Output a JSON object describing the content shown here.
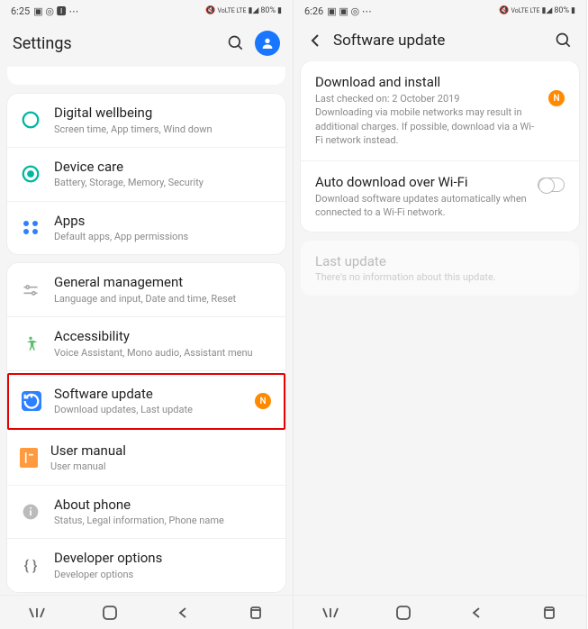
{
  "left": {
    "status": {
      "time": "6:25",
      "battery": "80%",
      "net": "VoLTE LTE"
    },
    "title": "Settings",
    "groups": [
      {
        "items": [
          {
            "icon": "wellbeing-icon",
            "title": "Digital wellbeing",
            "sub": "Screen time, App timers, Wind down"
          },
          {
            "icon": "device-care-icon",
            "title": "Device care",
            "sub": "Battery, Storage, Memory, Security"
          },
          {
            "icon": "apps-icon",
            "title": "Apps",
            "sub": "Default apps, App permissions"
          }
        ]
      },
      {
        "items": [
          {
            "icon": "sliders-icon",
            "title": "General management",
            "sub": "Language and input, Date and time, Reset"
          },
          {
            "icon": "accessibility-icon",
            "title": "Accessibility",
            "sub": "Voice Assistant, Mono audio, Assistant menu"
          },
          {
            "icon": "update-icon",
            "title": "Software update",
            "sub": "Download updates, Last update",
            "badge": "N",
            "highlight": true
          },
          {
            "icon": "manual-icon",
            "title": "User manual",
            "sub": "User manual"
          },
          {
            "icon": "info-icon",
            "title": "About phone",
            "sub": "Status, Legal information, Phone name"
          },
          {
            "icon": "dev-icon",
            "title": "Developer options",
            "sub": "Developer options"
          }
        ]
      }
    ]
  },
  "right": {
    "status": {
      "time": "6:26",
      "battery": "80%",
      "net": "VoLTE LTE"
    },
    "title": "Software update",
    "items": [
      {
        "title": "Download and install",
        "sub": "Last checked on: 2 October 2019\nDownloading via mobile networks may result in additional charges. If possible, download via a Wi-Fi network instead.",
        "badge": "N"
      },
      {
        "title": "Auto download over Wi-Fi",
        "sub": "Download software updates automatically when connected to a Wi-Fi network.",
        "toggle": true
      }
    ],
    "disabled": {
      "title": "Last update",
      "sub": "There's no information about this update."
    }
  }
}
